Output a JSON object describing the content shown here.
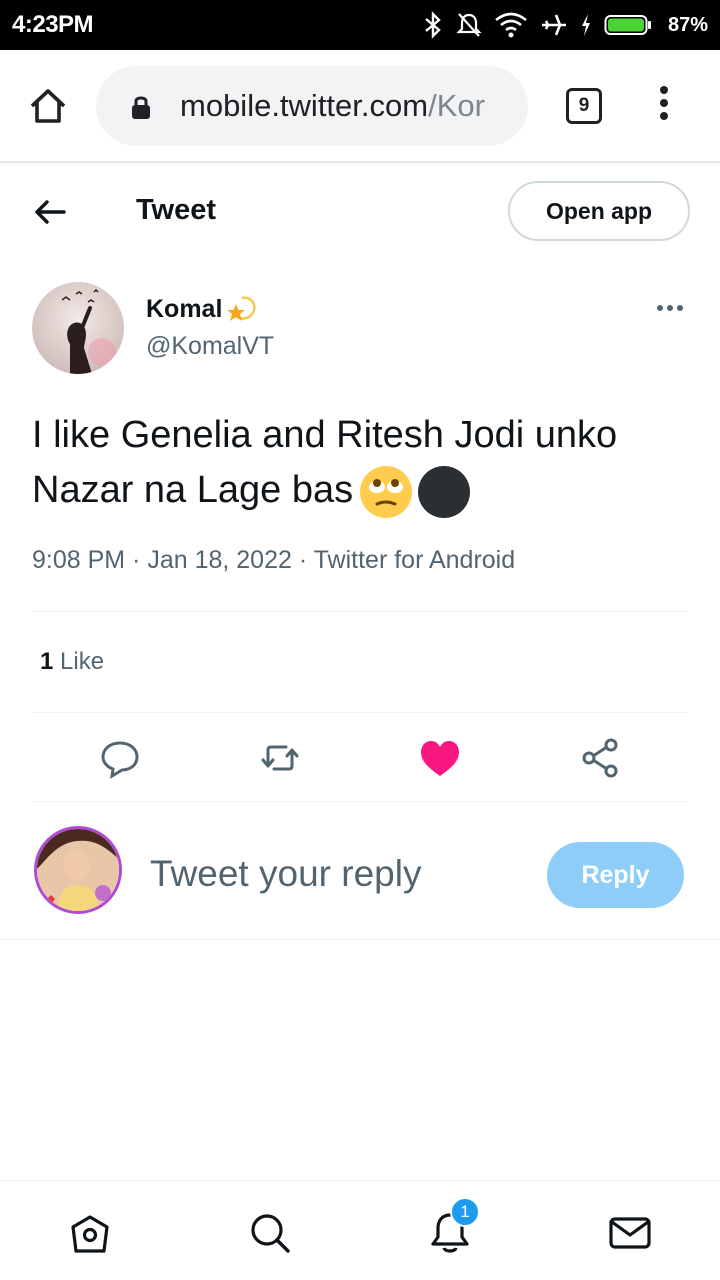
{
  "status_bar": {
    "time": "4:23PM",
    "battery_percent": "87%",
    "icons": [
      "bluetooth-icon",
      "mute-icon",
      "wifi-icon",
      "airplane-icon",
      "charging-icon",
      "battery-icon"
    ]
  },
  "browser": {
    "url_host": "mobile.twitter.com",
    "url_path": "/Kor",
    "tab_count": "9"
  },
  "header": {
    "title": "Tweet",
    "open_app_label": "Open app"
  },
  "tweet": {
    "author_name": "Komal",
    "author_handle": "@KomalVT",
    "text": "I like Genelia and Ritesh Jodi unko Nazar na Lage bas",
    "meta": "9:08 PM · Jan 18, 2022 · Twitter for Android",
    "like_count": "1",
    "like_label": "Like"
  },
  "reply": {
    "placeholder": "Tweet your reply",
    "button_label": "Reply"
  },
  "bottom_nav": {
    "notification_count": "1",
    "items": [
      "home-icon",
      "search-icon",
      "notifications-icon",
      "messages-icon"
    ]
  },
  "colors": {
    "accent": "#1d9bf0",
    "like": "#f91880",
    "reply_button": "#8ecdf8"
  }
}
